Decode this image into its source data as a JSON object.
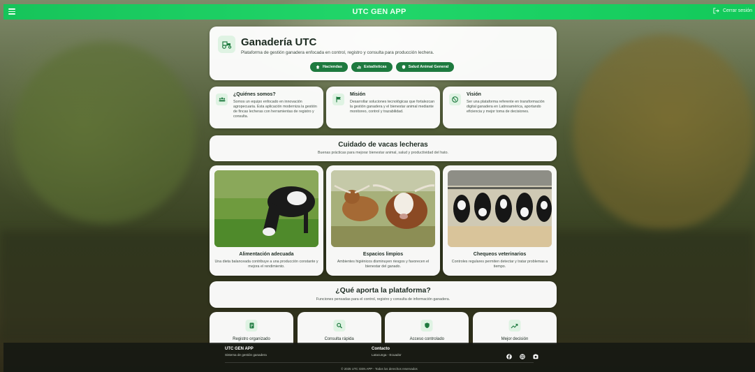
{
  "header": {
    "title": "UTC GEN APP",
    "logout_label": "Cerrar sesión"
  },
  "hero": {
    "title": "Ganadería UTC",
    "subtitle": "Plataforma de gestión ganadera enfocada en control, registro y consulta para producción lechera.",
    "buttons": [
      {
        "label": "Haciendas",
        "icon": "home-icon"
      },
      {
        "label": "Estadísticas",
        "icon": "bar-chart-icon"
      },
      {
        "label": "Salud Animal General",
        "icon": "shield-icon"
      }
    ]
  },
  "info_cards": [
    {
      "title": "¿Quiénes somos?",
      "text": "Somos un equipo enfocado en innovación agropecuaria. Esta aplicación moderniza la gestión de fincas lecheras con herramientas de registro y consulta.",
      "icon": "group-icon"
    },
    {
      "title": "Misión",
      "text": "Desarrollar soluciones tecnológicas que fortalezcan la gestión ganadera y el bienestar animal mediante monitoreo, control y trazabilidad.",
      "icon": "flag-icon"
    },
    {
      "title": "Visión",
      "text": "Ser una plataforma referente en transformación digital ganadera en Latinoamérica, aportando eficiencia y mejor toma de decisiones.",
      "icon": "globe-icon"
    }
  ],
  "care": {
    "title": "Cuidado de vacas lecheras",
    "subtitle": "Buenas prácticas para mejorar bienestar animal, salud y productividad del hato.",
    "cards": [
      {
        "title": "Alimentación adecuada",
        "text": "Una dieta balanceada contribuye a una producción constante y mejora el rendimiento."
      },
      {
        "title": "Espacios limpios",
        "text": "Ambientes higiénicos disminuyen riesgos y favorecen el bienestar del ganado."
      },
      {
        "title": "Chequeos veterinarios",
        "text": "Controles regulares permiten detectar y tratar problemas a tiempo."
      }
    ]
  },
  "platform": {
    "title": "¿Qué aporta la plataforma?",
    "subtitle": "Funciones pensadas para el control, registro y consulta de información ganadera.",
    "features": [
      {
        "title": "Registro organizado",
        "icon": "document-icon"
      },
      {
        "title": "Consulta rápida",
        "icon": "search-icon"
      },
      {
        "title": "Acceso controlado",
        "icon": "shield-icon"
      },
      {
        "title": "Mejor decisión",
        "icon": "trending-up-icon"
      }
    ]
  },
  "footer": {
    "brand": "UTC GEN APP",
    "brand_sub": "Sistema de gestión ganadera",
    "contact": "Contacto",
    "contact_sub": "Latacunga - Ecuador",
    "copyright": "© 2025 UTC GEN APP - Todos los derechos reservados"
  },
  "colors": {
    "accent": "#1e7a3f",
    "topbar": "#1fd064",
    "icon_bg": "#dff3e3"
  }
}
